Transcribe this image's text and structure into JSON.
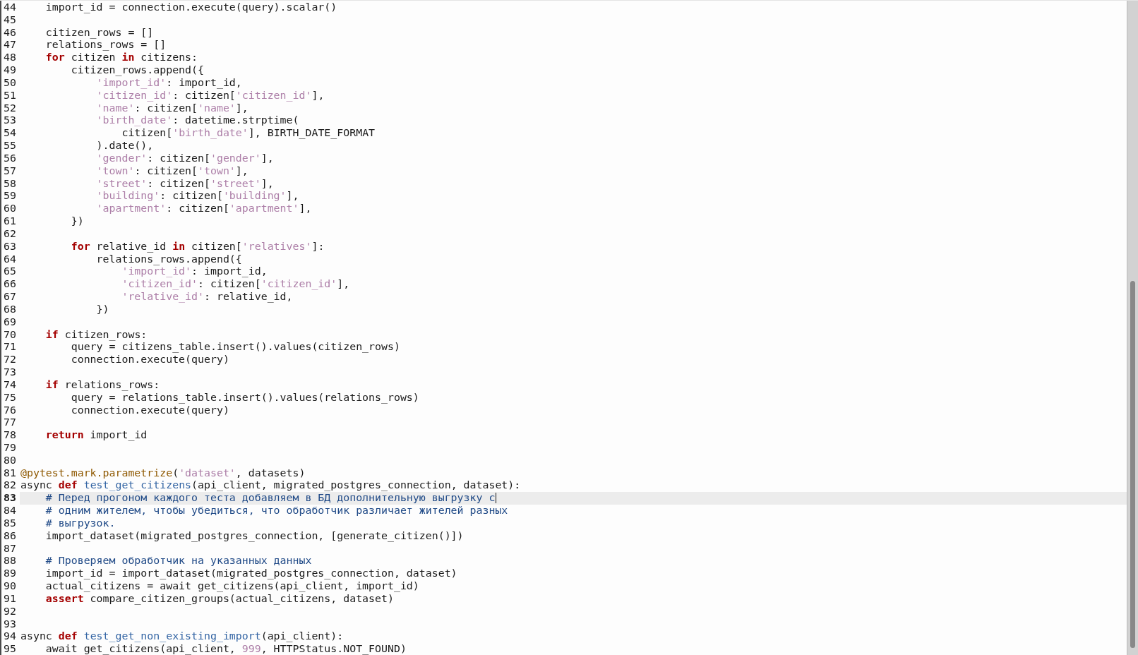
{
  "editor": {
    "lines": [
      {
        "number": "44",
        "current": false,
        "tokens": [
          {
            "kind": "plain",
            "text": "    import_id = connection.execute(query).scalar()"
          }
        ]
      },
      {
        "number": "45",
        "current": false
      },
      {
        "number": "46",
        "current": false,
        "tokens": [
          {
            "kind": "plain",
            "text": "    citizen_rows = []"
          }
        ]
      },
      {
        "number": "47",
        "current": false,
        "tokens": [
          {
            "kind": "plain",
            "text": "    relations_rows = []"
          }
        ]
      },
      {
        "number": "48",
        "current": false,
        "tokens": [
          {
            "kind": "keyword",
            "text": "    for"
          },
          {
            "kind": "plain",
            "text": " citizen "
          },
          {
            "kind": "keyword",
            "text": "in"
          },
          {
            "kind": "plain",
            "text": " citizens:"
          }
        ]
      },
      {
        "number": "49",
        "current": false,
        "tokens": [
          {
            "kind": "plain",
            "text": "        citizen_rows.append({"
          }
        ]
      },
      {
        "number": "50",
        "current": false,
        "tokens": [
          {
            "kind": "string",
            "text": "            'import_id'"
          },
          {
            "kind": "plain",
            "text": ": import_id,"
          }
        ]
      },
      {
        "number": "51",
        "current": false,
        "tokens": [
          {
            "kind": "string",
            "text": "            'citizen_id'"
          },
          {
            "kind": "plain",
            "text": ": citizen["
          },
          {
            "kind": "string",
            "text": "'citizen_id'"
          },
          {
            "kind": "plain",
            "text": "],"
          }
        ]
      },
      {
        "number": "52",
        "current": false,
        "tokens": [
          {
            "kind": "string",
            "text": "            'name'"
          },
          {
            "kind": "plain",
            "text": ": citizen["
          },
          {
            "kind": "string",
            "text": "'name'"
          },
          {
            "kind": "plain",
            "text": "],"
          }
        ]
      },
      {
        "number": "53",
        "current": false,
        "tokens": [
          {
            "kind": "string",
            "text": "            'birth_date'"
          },
          {
            "kind": "plain",
            "text": ": datetime.strptime("
          }
        ]
      },
      {
        "number": "54",
        "current": false,
        "tokens": [
          {
            "kind": "plain",
            "text": "                citizen["
          },
          {
            "kind": "string",
            "text": "'birth_date'"
          },
          {
            "kind": "plain",
            "text": "], BIRTH_DATE_FORMAT"
          }
        ]
      },
      {
        "number": "55",
        "current": false,
        "tokens": [
          {
            "kind": "plain",
            "text": "            ).date(),"
          }
        ]
      },
      {
        "number": "56",
        "current": false,
        "tokens": [
          {
            "kind": "string",
            "text": "            'gender'"
          },
          {
            "kind": "plain",
            "text": ": citizen["
          },
          {
            "kind": "string",
            "text": "'gender'"
          },
          {
            "kind": "plain",
            "text": "],"
          }
        ]
      },
      {
        "number": "57",
        "current": false,
        "tokens": [
          {
            "kind": "string",
            "text": "            'town'"
          },
          {
            "kind": "plain",
            "text": ": citizen["
          },
          {
            "kind": "string",
            "text": "'town'"
          },
          {
            "kind": "plain",
            "text": "],"
          }
        ]
      },
      {
        "number": "58",
        "current": false,
        "tokens": [
          {
            "kind": "string",
            "text": "            'street'"
          },
          {
            "kind": "plain",
            "text": ": citizen["
          },
          {
            "kind": "string",
            "text": "'street'"
          },
          {
            "kind": "plain",
            "text": "],"
          }
        ]
      },
      {
        "number": "59",
        "current": false,
        "tokens": [
          {
            "kind": "string",
            "text": "            'building'"
          },
          {
            "kind": "plain",
            "text": ": citizen["
          },
          {
            "kind": "string",
            "text": "'building'"
          },
          {
            "kind": "plain",
            "text": "],"
          }
        ]
      },
      {
        "number": "60",
        "current": false,
        "tokens": [
          {
            "kind": "string",
            "text": "            'apartment'"
          },
          {
            "kind": "plain",
            "text": ": citizen["
          },
          {
            "kind": "string",
            "text": "'apartment'"
          },
          {
            "kind": "plain",
            "text": "],"
          }
        ]
      },
      {
        "number": "61",
        "current": false,
        "tokens": [
          {
            "kind": "plain",
            "text": "        })"
          }
        ]
      },
      {
        "number": "62",
        "current": false
      },
      {
        "number": "63",
        "current": false,
        "tokens": [
          {
            "kind": "keyword",
            "text": "        for"
          },
          {
            "kind": "plain",
            "text": " relative_id "
          },
          {
            "kind": "keyword",
            "text": "in"
          },
          {
            "kind": "plain",
            "text": " citizen["
          },
          {
            "kind": "string",
            "text": "'relatives'"
          },
          {
            "kind": "plain",
            "text": "]:"
          }
        ]
      },
      {
        "number": "64",
        "current": false,
        "tokens": [
          {
            "kind": "plain",
            "text": "            relations_rows.append({"
          }
        ]
      },
      {
        "number": "65",
        "current": false,
        "tokens": [
          {
            "kind": "string",
            "text": "                'import_id'"
          },
          {
            "kind": "plain",
            "text": ": import_id,"
          }
        ]
      },
      {
        "number": "66",
        "current": false,
        "tokens": [
          {
            "kind": "string",
            "text": "                'citizen_id'"
          },
          {
            "kind": "plain",
            "text": ": citizen["
          },
          {
            "kind": "string",
            "text": "'citizen_id'"
          },
          {
            "kind": "plain",
            "text": "],"
          }
        ]
      },
      {
        "number": "67",
        "current": false,
        "tokens": [
          {
            "kind": "string",
            "text": "                'relative_id'"
          },
          {
            "kind": "plain",
            "text": ": relative_id,"
          }
        ]
      },
      {
        "number": "68",
        "current": false,
        "tokens": [
          {
            "kind": "plain",
            "text": "            })"
          }
        ]
      },
      {
        "number": "69",
        "current": false
      },
      {
        "number": "70",
        "current": false,
        "tokens": [
          {
            "kind": "keyword",
            "text": "    if"
          },
          {
            "kind": "plain",
            "text": " citizen_rows:"
          }
        ]
      },
      {
        "number": "71",
        "current": false,
        "tokens": [
          {
            "kind": "plain",
            "text": "        query = citizens_table.insert().values(citizen_rows)"
          }
        ]
      },
      {
        "number": "72",
        "current": false,
        "tokens": [
          {
            "kind": "plain",
            "text": "        connection.execute(query)"
          }
        ]
      },
      {
        "number": "73",
        "current": false
      },
      {
        "number": "74",
        "current": false,
        "tokens": [
          {
            "kind": "keyword",
            "text": "    if"
          },
          {
            "kind": "plain",
            "text": " relations_rows:"
          }
        ]
      },
      {
        "number": "75",
        "current": false,
        "tokens": [
          {
            "kind": "plain",
            "text": "        query = relations_table.insert().values(relations_rows)"
          }
        ]
      },
      {
        "number": "76",
        "current": false,
        "tokens": [
          {
            "kind": "plain",
            "text": "        connection.execute(query)"
          }
        ]
      },
      {
        "number": "77",
        "current": false
      },
      {
        "number": "78",
        "current": false,
        "tokens": [
          {
            "kind": "keyword",
            "text": "    return"
          },
          {
            "kind": "plain",
            "text": " import_id"
          }
        ]
      },
      {
        "number": "79",
        "current": false
      },
      {
        "number": "80",
        "current": false
      },
      {
        "number": "81",
        "current": false,
        "tokens": [
          {
            "kind": "decorator",
            "text": "@pytest.mark.parametrize"
          },
          {
            "kind": "plain",
            "text": "("
          },
          {
            "kind": "string",
            "text": "'dataset'"
          },
          {
            "kind": "plain",
            "text": ", datasets)"
          }
        ]
      },
      {
        "number": "82",
        "current": false,
        "tokens": [
          {
            "kind": "plain",
            "text": "async "
          },
          {
            "kind": "keyword",
            "text": "def"
          },
          {
            "kind": "function",
            "text": " test_get_citizens"
          },
          {
            "kind": "plain",
            "text": "(api_client, migrated_postgres_connection, dataset):"
          }
        ]
      },
      {
        "number": "83",
        "current": true,
        "tokens": [
          {
            "kind": "comment",
            "text": "    # Перед прогоном каждого теста добавляем в БД дополнительную выгрузку с"
          }
        ]
      },
      {
        "number": "84",
        "current": false,
        "tokens": [
          {
            "kind": "comment",
            "text": "    # одним жителем, чтобы убедиться, что обработчик различает жителей разных"
          }
        ]
      },
      {
        "number": "85",
        "current": false,
        "tokens": [
          {
            "kind": "comment",
            "text": "    # выгрузок."
          }
        ]
      },
      {
        "number": "86",
        "current": false,
        "tokens": [
          {
            "kind": "plain",
            "text": "    import_dataset(migrated_postgres_connection, [generate_citizen()])"
          }
        ]
      },
      {
        "number": "87",
        "current": false
      },
      {
        "number": "88",
        "current": false,
        "tokens": [
          {
            "kind": "comment",
            "text": "    # Проверяем обработчик на указанных данных"
          }
        ]
      },
      {
        "number": "89",
        "current": false,
        "tokens": [
          {
            "kind": "plain",
            "text": "    import_id = import_dataset(migrated_postgres_connection, dataset)"
          }
        ]
      },
      {
        "number": "90",
        "current": false,
        "tokens": [
          {
            "kind": "plain",
            "text": "    actual_citizens = await get_citizens(api_client, import_id)"
          }
        ]
      },
      {
        "number": "91",
        "current": false,
        "tokens": [
          {
            "kind": "keyword",
            "text": "    assert"
          },
          {
            "kind": "plain",
            "text": " compare_citizen_groups(actual_citizens, dataset)"
          }
        ]
      },
      {
        "number": "92",
        "current": false
      },
      {
        "number": "93",
        "current": false
      },
      {
        "number": "94",
        "current": false,
        "tokens": [
          {
            "kind": "plain",
            "text": "async "
          },
          {
            "kind": "keyword",
            "text": "def"
          },
          {
            "kind": "function",
            "text": " test_get_non_existing_import"
          },
          {
            "kind": "plain",
            "text": "(api_client):"
          }
        ]
      },
      {
        "number": "95",
        "current": false,
        "tokens": [
          {
            "kind": "plain",
            "text": "    await get_citizens(api_client, "
          },
          {
            "kind": "number",
            "text": "999"
          },
          {
            "kind": "plain",
            "text": ", HTTPStatus.NOT_FOUND)"
          }
        ]
      }
    ]
  }
}
